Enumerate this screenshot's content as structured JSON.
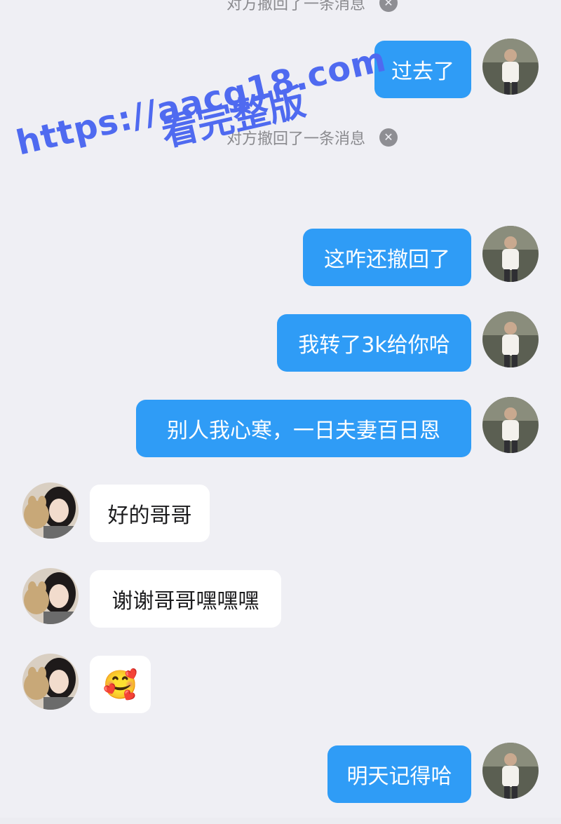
{
  "system_notices": [
    {
      "text": "对方撤回了一条消息"
    },
    {
      "text": "对方撤回了一条消息"
    }
  ],
  "messages": [
    {
      "side": "sent",
      "text": "过去了"
    },
    {
      "side": "sent",
      "text": "这咋还撤回了"
    },
    {
      "side": "sent",
      "text": "我转了3k给你哈"
    },
    {
      "side": "sent",
      "text": "别人我心寒，一日夫妻百日恩"
    },
    {
      "side": "received",
      "text": "好的哥哥"
    },
    {
      "side": "received",
      "text": "谢谢哥哥嘿嘿嘿"
    },
    {
      "side": "received",
      "text": "🥰",
      "emoji": "hugging-face"
    },
    {
      "side": "sent",
      "text": "明天记得哈"
    }
  ],
  "watermark": {
    "url": "https://aacg18.com",
    "sub": "看完整版"
  },
  "colors": {
    "sent_bubble": "#2f9cf6",
    "received_bubble": "#ffffff",
    "background": "#efeff4",
    "watermark": "#4f6af0"
  }
}
